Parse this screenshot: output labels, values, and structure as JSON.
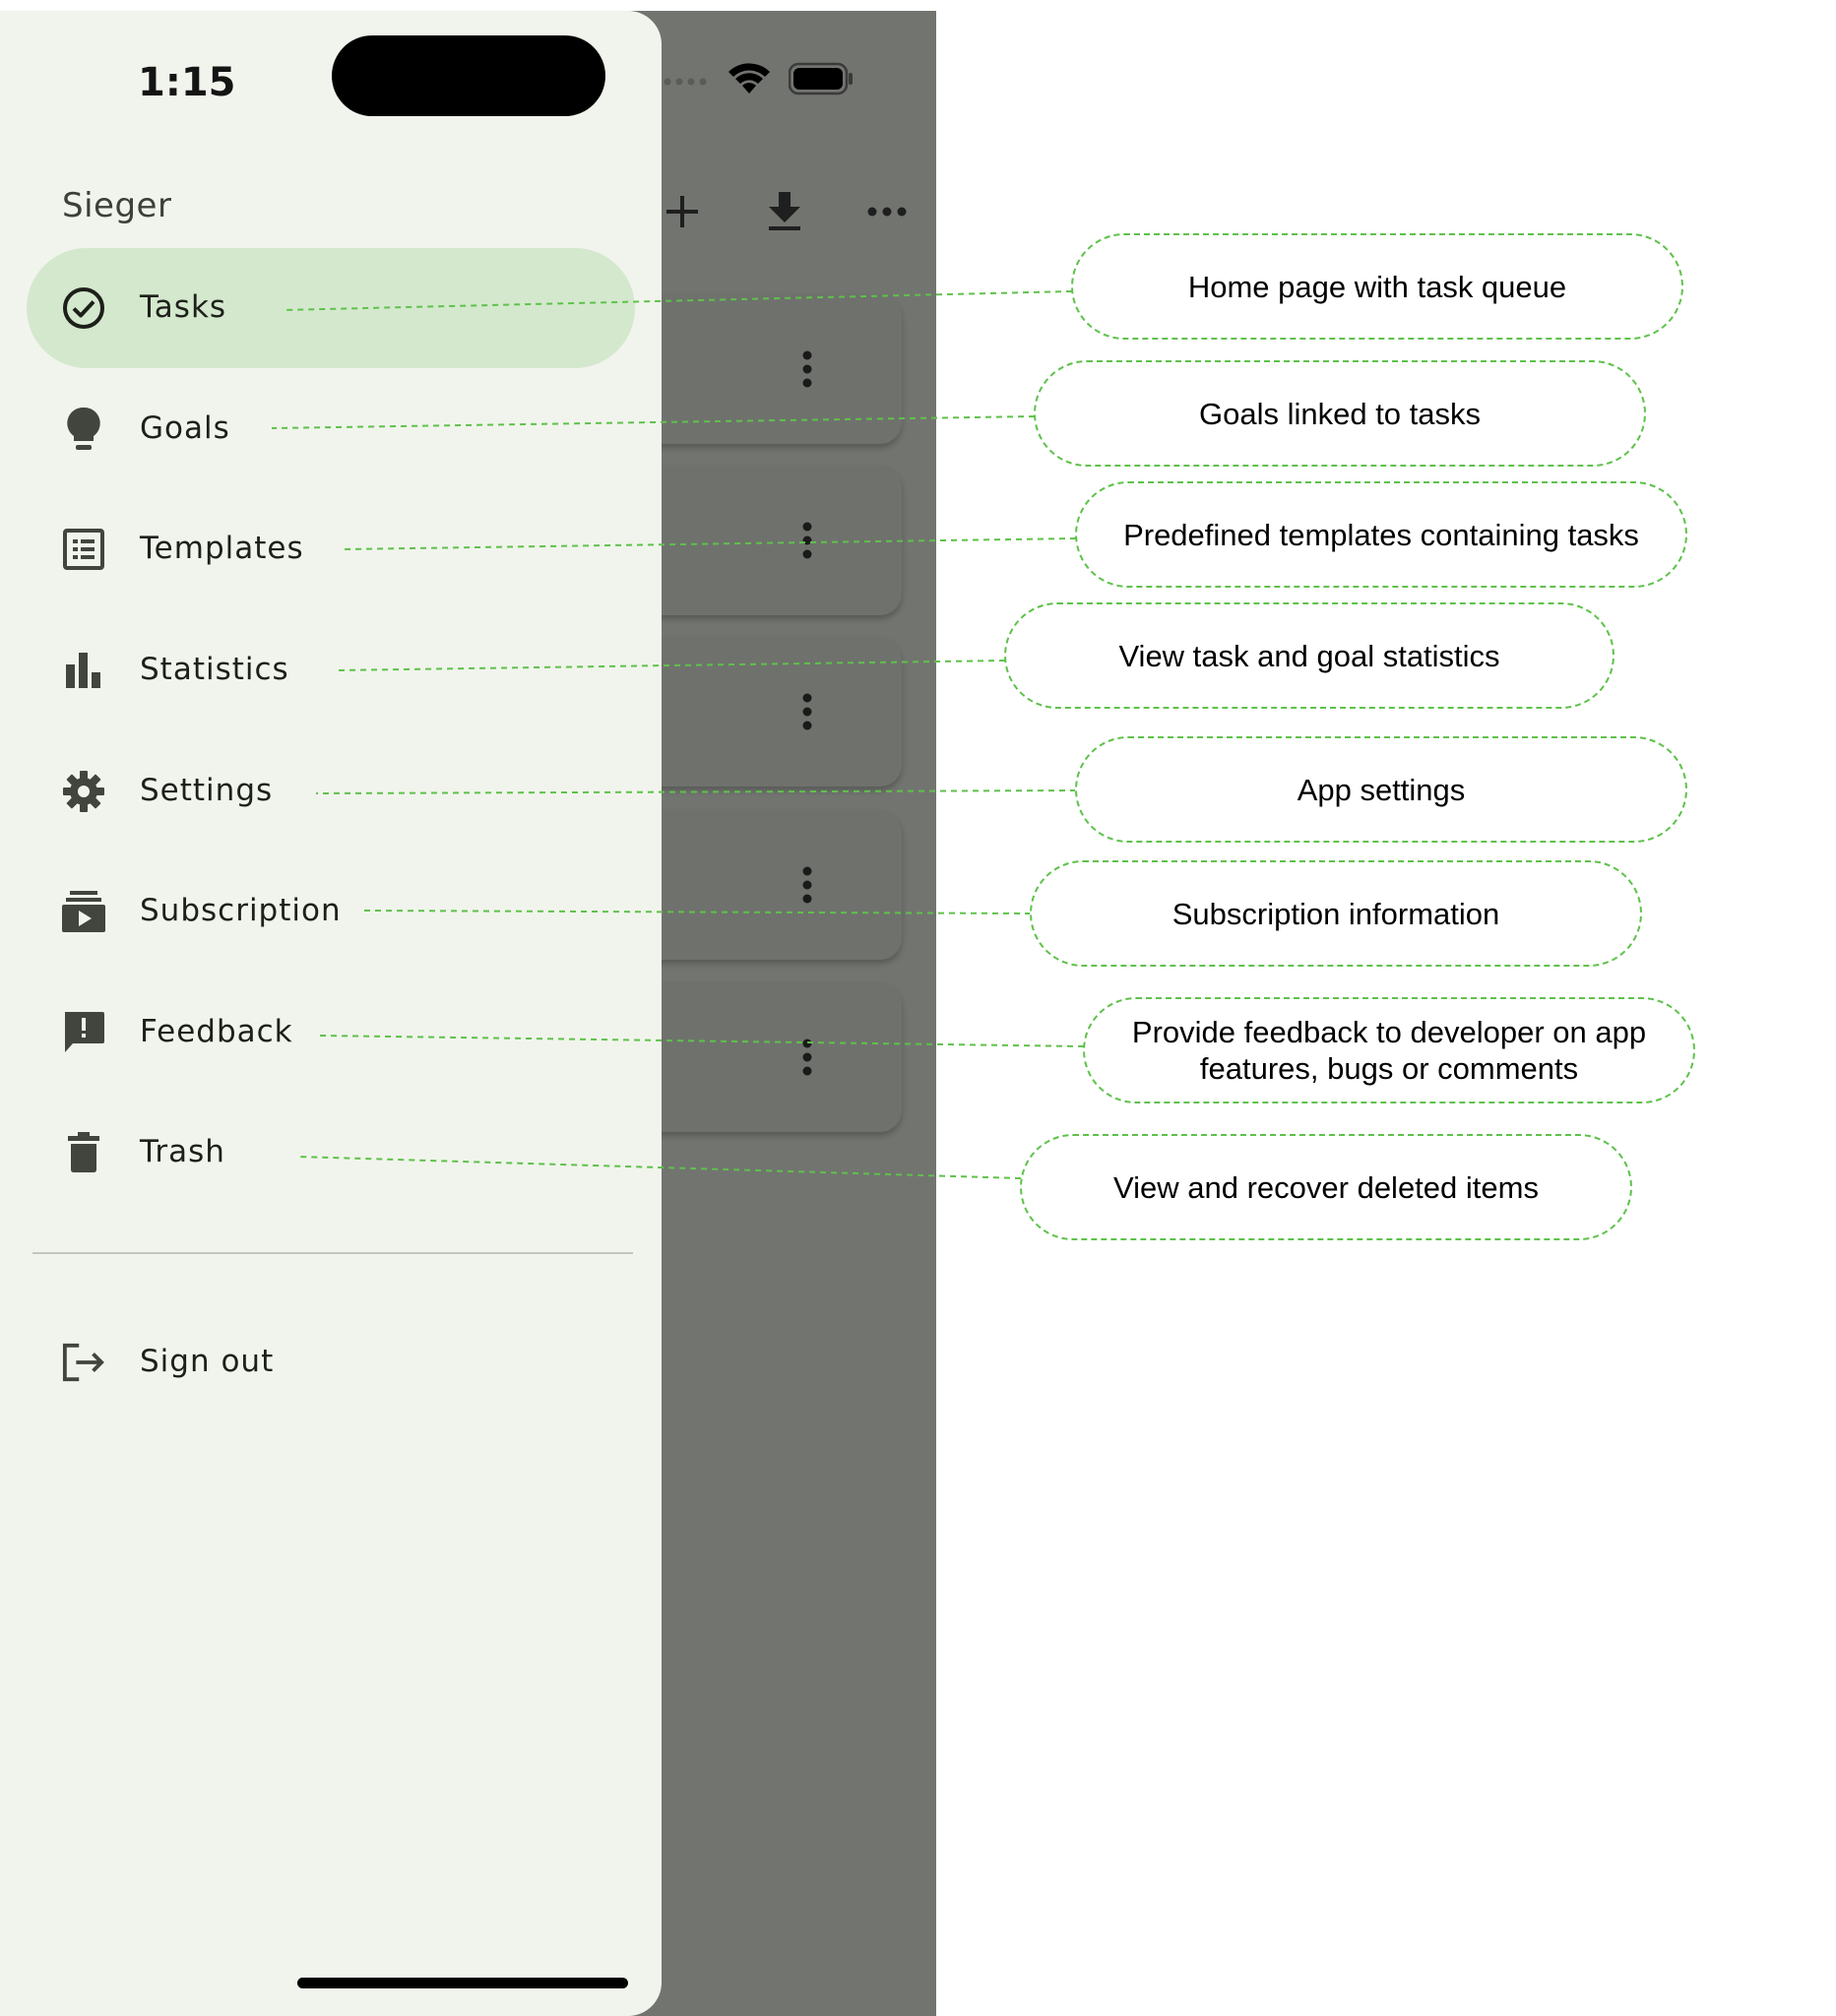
{
  "status_bar": {
    "time": "1:15"
  },
  "drawer": {
    "title": "Sieger",
    "items": [
      {
        "label": "Tasks",
        "icon": "check-circle-icon",
        "active": true
      },
      {
        "label": "Goals",
        "icon": "lightbulb-icon",
        "active": false
      },
      {
        "label": "Templates",
        "icon": "list-alt-icon",
        "active": false
      },
      {
        "label": "Statistics",
        "icon": "bar-chart-icon",
        "active": false
      },
      {
        "label": "Settings",
        "icon": "gear-icon",
        "active": false
      },
      {
        "label": "Subscription",
        "icon": "subscriptions-icon",
        "active": false
      },
      {
        "label": "Feedback",
        "icon": "feedback-icon",
        "active": false
      },
      {
        "label": "Trash",
        "icon": "trash-icon",
        "active": false
      }
    ],
    "sign_out": {
      "label": "Sign out",
      "icon": "logout-icon"
    }
  },
  "annotations": [
    "Home page with task queue",
    "Goals linked to tasks",
    "Predefined templates containing tasks",
    "View task and goal statistics",
    "App settings",
    "Subscription information",
    "Provide feedback to developer on app features, bugs or comments",
    "View and recover deleted items"
  ],
  "colors": {
    "drawer_bg": "#f1f4ec",
    "active_item_bg": "#d4e8ce",
    "scrim": "#727470",
    "annotation_line": "#5ec24a"
  }
}
